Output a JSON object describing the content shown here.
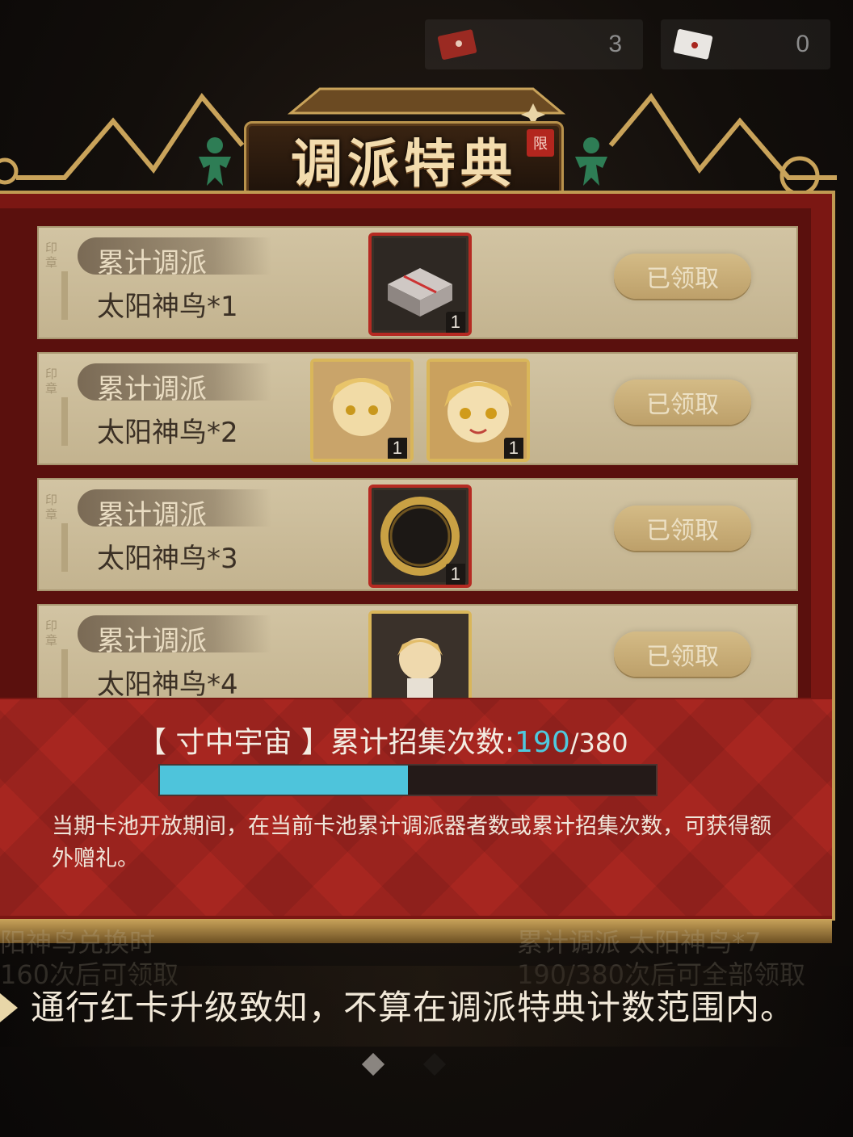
{
  "currencies": [
    {
      "icon": "red-envelope-icon",
      "value": "3"
    },
    {
      "icon": "white-envelope-icon",
      "value": "0"
    }
  ],
  "title": "调派特典",
  "seal": "限",
  "rows": [
    {
      "tag": "累计调派",
      "requirement": "太阳神鸟*1",
      "claim": "已领取",
      "items": [
        {
          "icon": "gift-box-icon",
          "count": "1",
          "frame": "red"
        }
      ]
    },
    {
      "tag": "累计调派",
      "requirement": "太阳神鸟*2",
      "claim": "已领取",
      "items": [
        {
          "icon": "character-portrait-icon",
          "count": "1",
          "frame": "gold"
        },
        {
          "icon": "character-chibi-portrait-icon",
          "count": "1",
          "frame": "gold"
        }
      ]
    },
    {
      "tag": "累计调派",
      "requirement": "太阳神鸟*3",
      "claim": "已领取",
      "items": [
        {
          "icon": "golden-ring-frame-icon",
          "count": "1",
          "frame": "red"
        }
      ]
    },
    {
      "tag": "累计调派",
      "requirement": "太阳神鸟*4",
      "claim": "已领取",
      "items": [
        {
          "icon": "chibi-figure-icon",
          "count": "",
          "frame": "gold"
        }
      ]
    }
  ],
  "progress": {
    "label": "【 寸中宇宙 】累计招集次数:",
    "current": "190",
    "separator": "/",
    "total": "380",
    "fraction": 0.5
  },
  "description": "当期卡池开放期间，在当前卡池累计调派器者数或累计招集次数，可获得额外赠礼。",
  "background_text": {
    "left_line1": "阳神鸟兑换时",
    "left_line2": "160次后可领取",
    "right_line1": "累计调派 太阳神鸟*7",
    "right_line2": "190/380次后可全部领取"
  },
  "notice": "通行红卡升级致知，不算在调派特典计数范围内。"
}
